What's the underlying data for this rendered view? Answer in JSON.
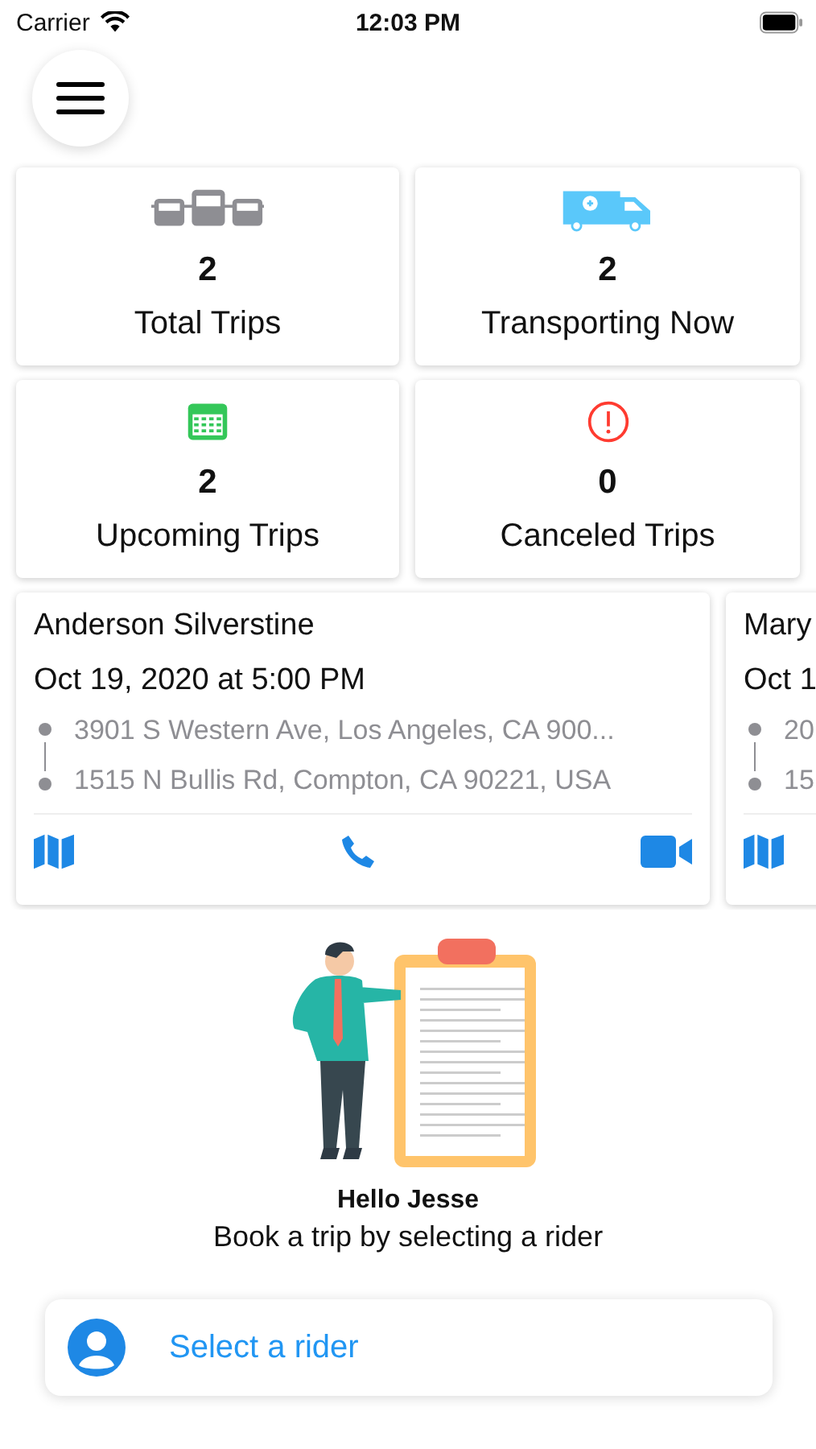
{
  "status_bar": {
    "carrier": "Carrier",
    "time": "12:03 PM"
  },
  "stats": [
    {
      "kind": "vans",
      "count": "2",
      "label": "Total Trips"
    },
    {
      "kind": "ambulance",
      "count": "2",
      "label": "Transporting Now"
    },
    {
      "kind": "calendar",
      "count": "2",
      "label": "Upcoming Trips"
    },
    {
      "kind": "alert",
      "count": "0",
      "label": "Canceled Trips"
    }
  ],
  "trips": [
    {
      "rider": "Anderson Silverstine",
      "when": "Oct 19, 2020 at 5:00 PM",
      "pickup": "3901 S Western Ave, Los Angeles, CA 900...",
      "dropoff": "1515 N Bullis Rd, Compton, CA 90221, USA",
      "actions": [
        {
          "kind": "map"
        },
        {
          "kind": "phone"
        },
        {
          "kind": "video"
        }
      ]
    },
    {
      "rider": "Mary",
      "when": "Oct 1",
      "pickup": "20",
      "dropoff": "15",
      "actions": [
        {
          "kind": "map"
        }
      ]
    }
  ],
  "greeting": "Hello Jesse",
  "prompt": "Book a trip by selecting a rider",
  "select_button": "Select a rider"
}
